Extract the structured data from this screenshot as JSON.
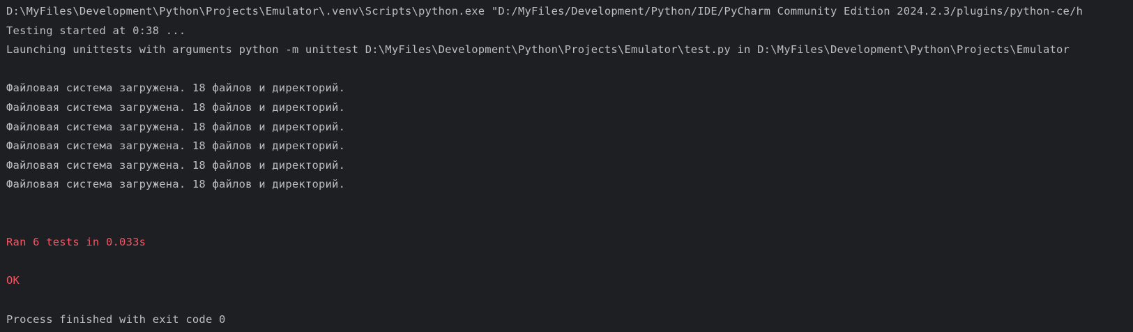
{
  "console": {
    "colors": {
      "background": "#1e1f22",
      "text": "#bcbec4",
      "error": "#f75464"
    },
    "lines": [
      {
        "text": "D:\\MyFiles\\Development\\Python\\Projects\\Emulator\\.venv\\Scripts\\python.exe \"D:/MyFiles/Development/Python/IDE/PyCharm Community Edition 2024.2.3/plugins/python-ce/h",
        "style": "normal"
      },
      {
        "text": "Testing started at 0:38 ...",
        "style": "normal"
      },
      {
        "text": "Launching unittests with arguments python -m unittest D:\\MyFiles\\Development\\Python\\Projects\\Emulator\\test.py in D:\\MyFiles\\Development\\Python\\Projects\\Emulator",
        "style": "normal"
      },
      {
        "text": "",
        "style": "normal"
      },
      {
        "text": "Файловая система загружена. 18 файлов и директорий.",
        "style": "normal"
      },
      {
        "text": "Файловая система загружена. 18 файлов и директорий.",
        "style": "normal"
      },
      {
        "text": "Файловая система загружена. 18 файлов и директорий.",
        "style": "normal"
      },
      {
        "text": "Файловая система загружена. 18 файлов и директорий.",
        "style": "normal"
      },
      {
        "text": "Файловая система загружена. 18 файлов и директорий.",
        "style": "normal"
      },
      {
        "text": "Файловая система загружена. 18 файлов и директорий.",
        "style": "normal"
      },
      {
        "text": "",
        "style": "normal"
      },
      {
        "text": "",
        "style": "normal"
      },
      {
        "text": "Ran 6 tests in 0.033s",
        "style": "red"
      },
      {
        "text": "",
        "style": "normal"
      },
      {
        "text": "OK",
        "style": "red"
      },
      {
        "text": "",
        "style": "normal"
      },
      {
        "text": "Process finished with exit code 0",
        "style": "normal"
      }
    ]
  }
}
